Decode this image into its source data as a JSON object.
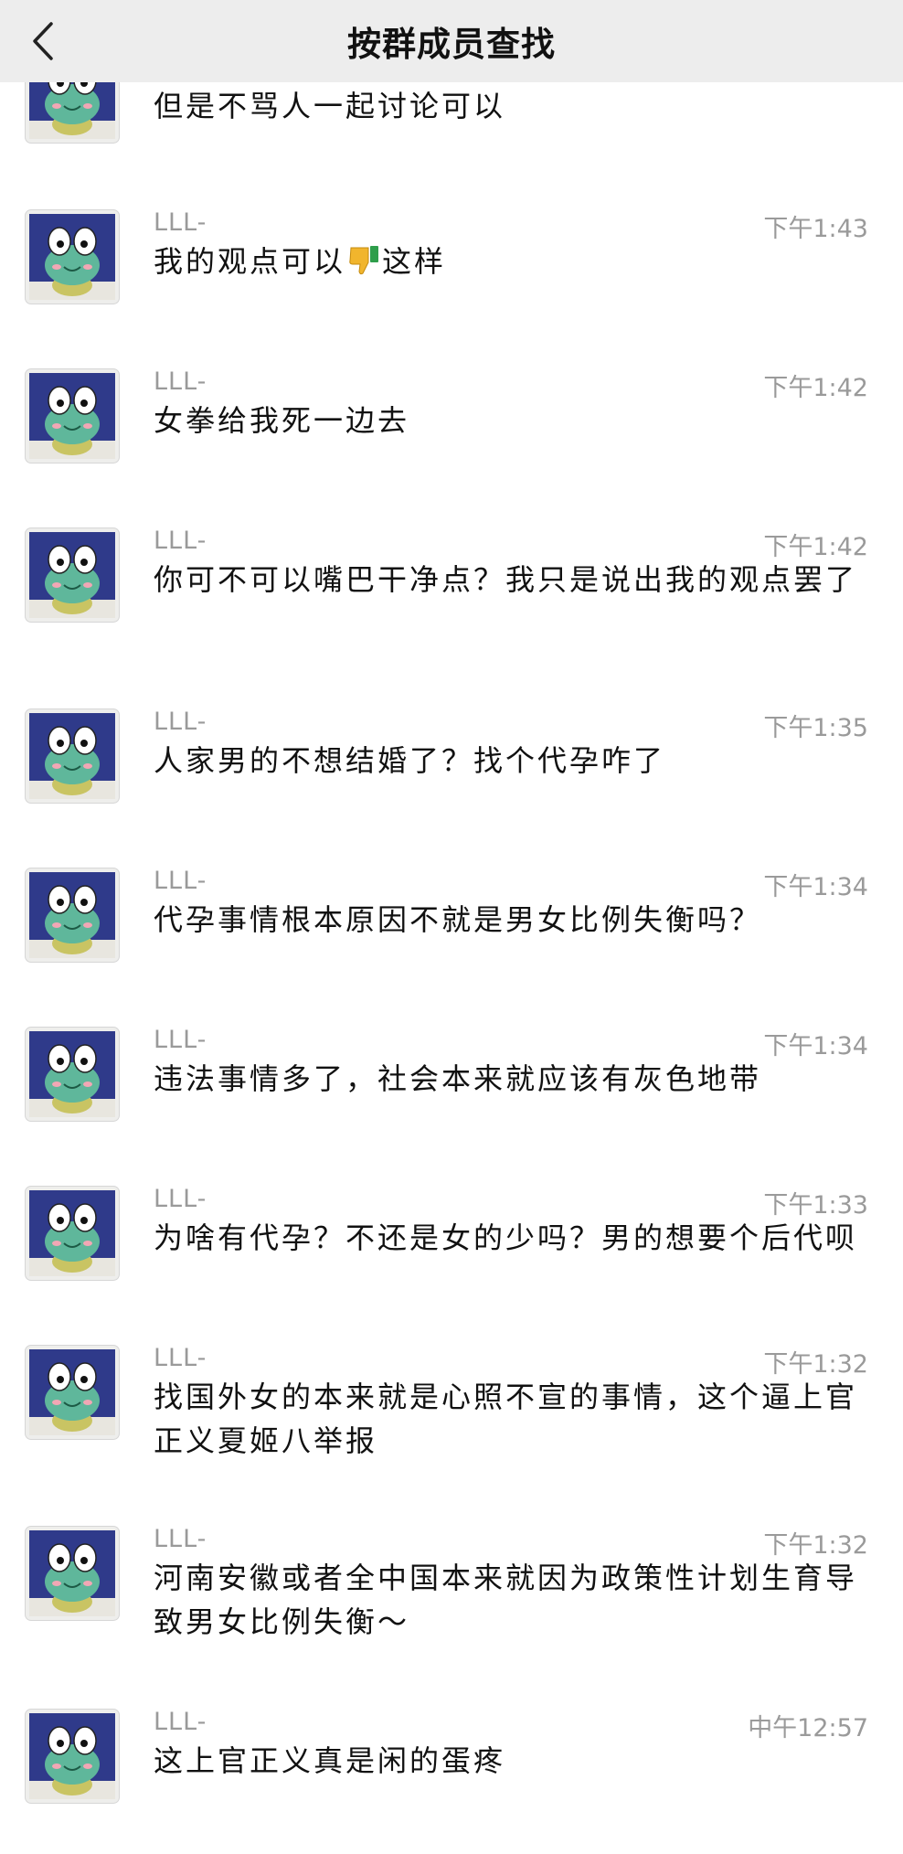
{
  "header": {
    "title": "按群成员查找",
    "back_icon": "chevron-left-icon"
  },
  "messages": [
    {
      "name": "",
      "time": "",
      "text_before": "但是不骂人一起讨论可以",
      "text_after": ""
    },
    {
      "name": "LLL-",
      "time": "下午1:43",
      "text_before": "我的观点可以",
      "emoji": "thumbs-down-icon",
      "text_after": "这样"
    },
    {
      "name": "LLL-",
      "time": "下午1:42",
      "text_before": "女拳给我死一边去",
      "text_after": ""
    },
    {
      "name": "LLL-",
      "time": "下午1:42",
      "text_before": "你可不可以嘴巴干净点？我只是说出我的观点罢了",
      "text_after": ""
    },
    {
      "name": "LLL-",
      "time": "下午1:35",
      "text_before": "人家男的不想结婚了？找个代孕咋了",
      "text_after": ""
    },
    {
      "name": "LLL-",
      "time": "下午1:34",
      "text_before": "代孕事情根本原因不就是男女比例失衡吗？",
      "text_after": ""
    },
    {
      "name": "LLL-",
      "time": "下午1:34",
      "text_before": "违法事情多了，社会本来就应该有灰色地带",
      "text_after": ""
    },
    {
      "name": "LLL-",
      "time": "下午1:33",
      "text_before": "为啥有代孕？不还是女的少吗？男的想要个后代呗",
      "text_after": ""
    },
    {
      "name": "LLL-",
      "time": "下午1:32",
      "text_before": "找国外女的本来就是心照不宣的事情，这个逼上官正义夏姬八举报",
      "text_after": ""
    },
    {
      "name": "LLL-",
      "time": "下午1:32",
      "text_before": "河南安徽或者全中国本来就因为政策性计划生育导致男女比例失衡～",
      "text_after": ""
    },
    {
      "name": "LLL-",
      "time": "中午12:57",
      "text_before": "这上官正义真是闲的蛋疼",
      "text_after": ""
    }
  ]
}
